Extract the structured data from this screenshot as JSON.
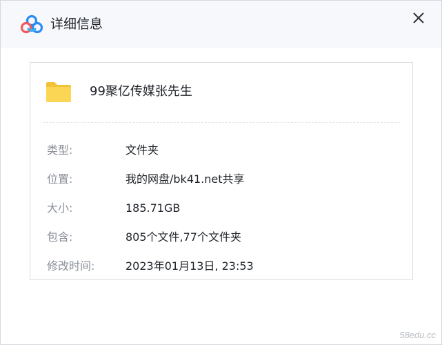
{
  "window": {
    "title": "详细信息"
  },
  "file": {
    "name": "99聚亿传媒张先生"
  },
  "details": [
    {
      "label": "类型:",
      "value": "文件夹"
    },
    {
      "label": "位置:",
      "value": "我的网盘/bk41.net共享"
    },
    {
      "label": "大小:",
      "value": "185.71GB"
    },
    {
      "label": "包含:",
      "value": "805个文件,77个文件夹"
    },
    {
      "label": "修改时间:",
      "value": "2023年01月13日, 23:53"
    }
  ],
  "watermark": "58edu.cc",
  "colors": {
    "folder": "#f9cf46",
    "logo_blue": "#2a8cf6",
    "logo_red": "#f25b5b",
    "text_primary": "#1f2329",
    "text_secondary": "#8a8f98"
  }
}
